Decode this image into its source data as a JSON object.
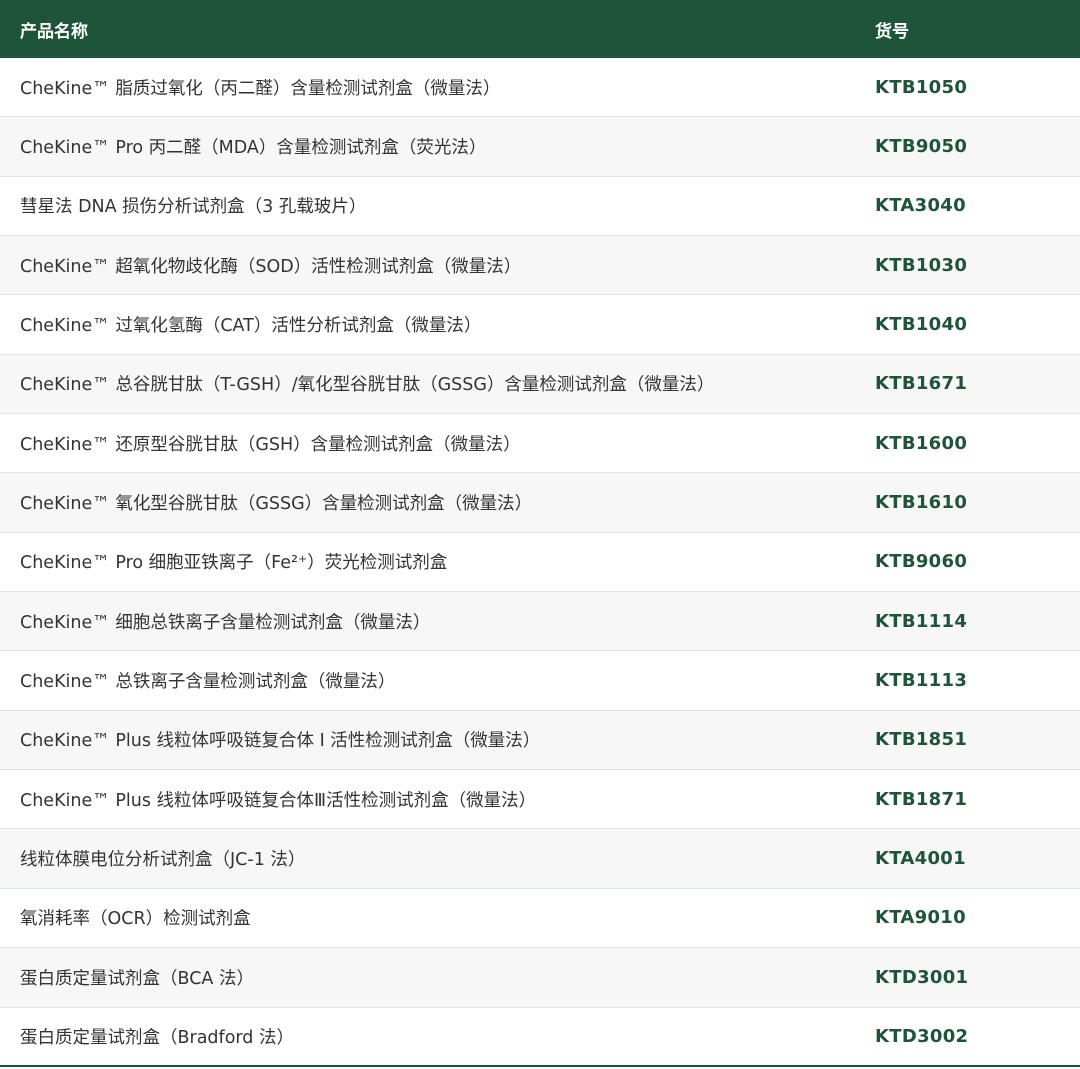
{
  "table": {
    "headers": {
      "name": "产品名称",
      "code": "货号"
    },
    "rows": [
      {
        "name": "CheKine™ 脂质过氧化（丙二醛）含量检测试剂盒（微量法）",
        "code": "KTB1050"
      },
      {
        "name": "CheKine™ Pro 丙二醛（MDA）含量检测试剂盒（荧光法）",
        "code": "KTB9050"
      },
      {
        "name": "彗星法 DNA 损伤分析试剂盒（3 孔载玻片）",
        "code": "KTA3040"
      },
      {
        "name": "CheKine™ 超氧化物歧化酶（SOD）活性检测试剂盒（微量法）",
        "code": "KTB1030"
      },
      {
        "name": "CheKine™ 过氧化氢酶（CAT）活性分析试剂盒（微量法）",
        "code": "KTB1040"
      },
      {
        "name": "CheKine™ 总谷胱甘肽（T-GSH）/氧化型谷胱甘肽（GSSG）含量检测试剂盒（微量法）",
        "code": "KTB1671"
      },
      {
        "name": "CheKine™ 还原型谷胱甘肽（GSH）含量检测试剂盒（微量法）",
        "code": "KTB1600"
      },
      {
        "name": "CheKine™ 氧化型谷胱甘肽（GSSG）含量检测试剂盒（微量法）",
        "code": "KTB1610"
      },
      {
        "name": "CheKine™ Pro 细胞亚铁离子（Fe²⁺）荧光检测试剂盒",
        "code": "KTB9060"
      },
      {
        "name": "CheKine™ 细胞总铁离子含量检测试剂盒（微量法）",
        "code": "KTB1114"
      },
      {
        "name": "CheKine™ 总铁离子含量检测试剂盒（微量法）",
        "code": "KTB1113"
      },
      {
        "name": "CheKine™ Plus 线粒体呼吸链复合体 I 活性检测试剂盒（微量法）",
        "code": "KTB1851"
      },
      {
        "name": "CheKine™ Plus 线粒体呼吸链复合体Ⅲ活性检测试剂盒（微量法）",
        "code": "KTB1871"
      },
      {
        "name": "线粒体膜电位分析试剂盒（JC-1 法）",
        "code": "KTA4001"
      },
      {
        "name": "氧消耗率（OCR）检测试剂盒",
        "code": "KTA9010"
      },
      {
        "name": "蛋白质定量试剂盒（BCA 法）",
        "code": "KTD3001"
      },
      {
        "name": "蛋白质定量试剂盒（Bradford 法）",
        "code": "KTD3002"
      }
    ]
  },
  "colors": {
    "header_bg": "#1e5438",
    "code_text": "#1e5438",
    "row_alt_bg": "#f6f7f6"
  }
}
